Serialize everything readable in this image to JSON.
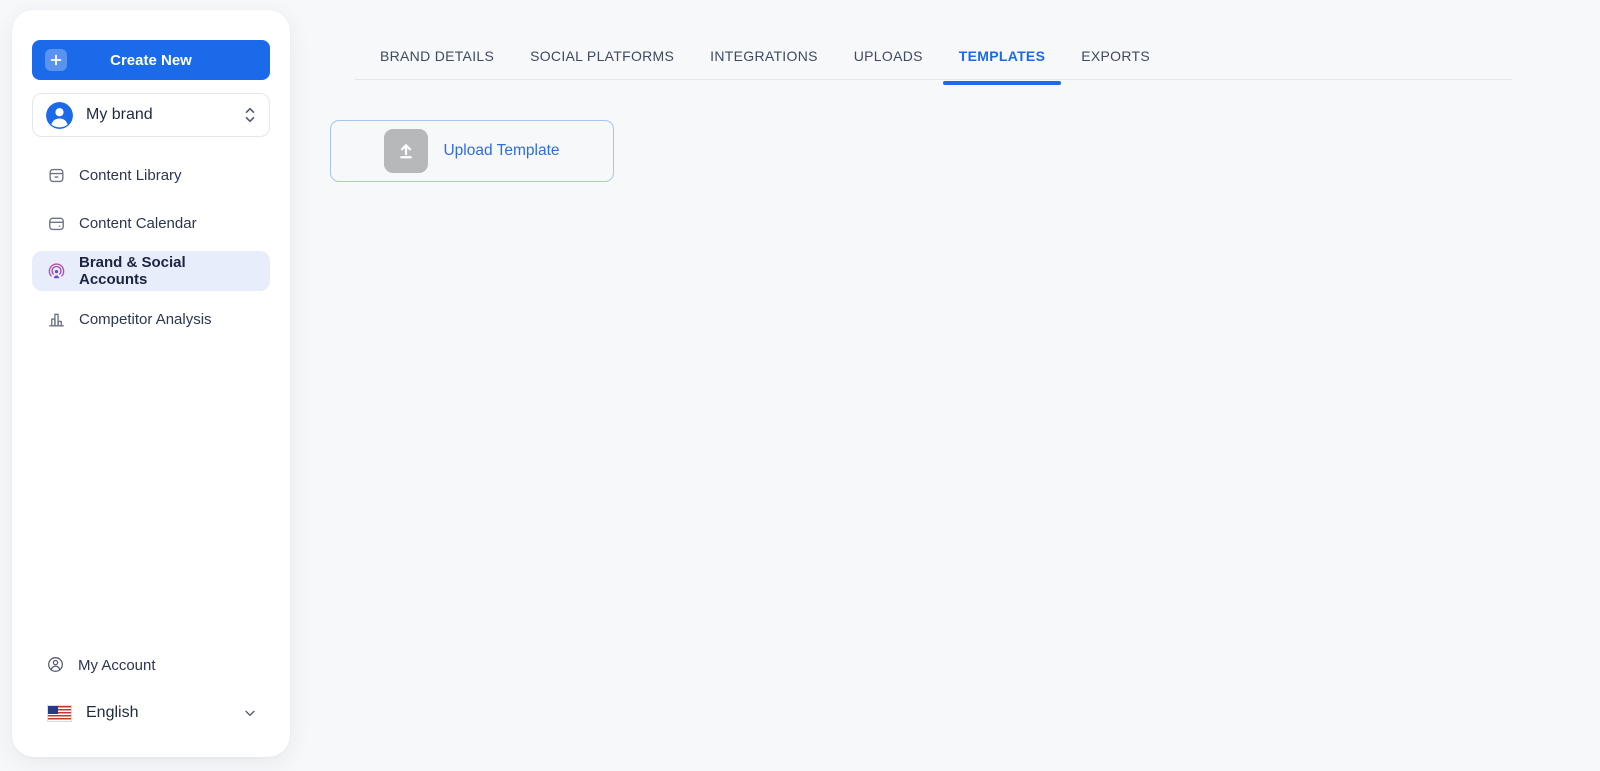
{
  "sidebar": {
    "create_new_label": "Create New",
    "brand_selector": {
      "label": "My brand",
      "icon": "avatar-icon"
    },
    "items": [
      {
        "label": "Content Library",
        "icon": "archive-icon",
        "active": false
      },
      {
        "label": "Content Calendar",
        "icon": "calendar-icon",
        "active": false
      },
      {
        "label": "Brand & Social Accounts",
        "icon": "broadcast-person-icon",
        "active": true
      },
      {
        "label": "Competitor Analysis",
        "icon": "bar-chart-icon",
        "active": false
      }
    ],
    "footer": {
      "my_account_label": "My Account",
      "language": {
        "label": "English",
        "flag": "us-flag-icon"
      }
    }
  },
  "main": {
    "tabs": [
      {
        "label": "BRAND DETAILS",
        "active": false
      },
      {
        "label": "SOCIAL PLATFORMS",
        "active": false
      },
      {
        "label": "INTEGRATIONS",
        "active": false
      },
      {
        "label": "UPLOADS",
        "active": false
      },
      {
        "label": "TEMPLATES",
        "active": true
      },
      {
        "label": "EXPORTS",
        "active": false
      }
    ],
    "upload": {
      "label": "Upload Template",
      "icon": "upload-icon"
    }
  },
  "colors": {
    "primary_blue": "#1b6ae9",
    "active_item_bg": "#e8edfb",
    "upload_border": "#a9c4f2",
    "upload_icon_bg": "#b7b8ba",
    "upload_text": "#2e6cdf",
    "page_bg": "#f7f8fa",
    "sidebar_bg": "#ffffff",
    "text_dark": "#1e2943",
    "tab_text": "#3f4a60"
  }
}
